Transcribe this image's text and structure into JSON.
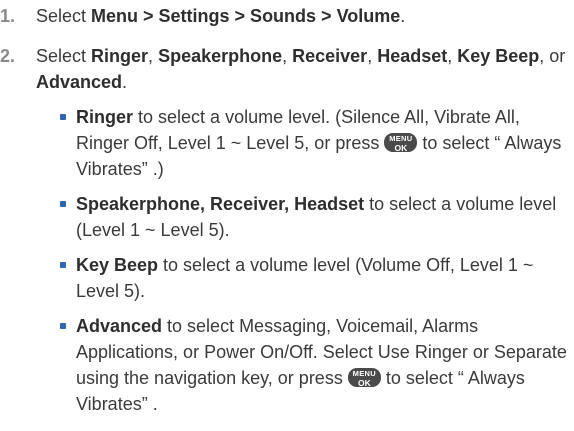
{
  "steps": [
    {
      "num": "1.",
      "text": {
        "pre": "Select ",
        "bold": "Menu > Settings > Sounds > Volume",
        "post": "."
      }
    },
    {
      "num": "2.",
      "text": {
        "pre": "Select ",
        "b1": "Ringer",
        "s1": ", ",
        "b2": "Speakerphone",
        "s2": ", ",
        "b3": "Receiver",
        "s3": ", ",
        "b4": "Headset",
        "s4": ", ",
        "b5": "Key Beep",
        "s5": ", or ",
        "b6": "Advanced",
        "post": "."
      },
      "subs": [
        {
          "bold": "Ringer",
          "text": " to select a volume level. (Silence All, Vibrate All, Ringer Off, Level 1 ~ Level 5, or press ",
          "after_key": " to select “ Always Vibrates” .)"
        },
        {
          "bold": "Speakerphone, Receiver, Headset",
          "text": " to select a volume level (Level 1 ~ Level 5)."
        },
        {
          "bold": "Key Beep",
          "text": " to select a volume level (Volume Off, Level 1 ~ Level 5)."
        },
        {
          "bold": "Advanced",
          "text": " to select Messaging, Voicemail, Alarms Applications, or Power On/Off. Select Use Ringer or Separate using the navigation key, or press ",
          "after_key": " to select “ Always Vibrates” ."
        }
      ]
    }
  ],
  "menu_key": {
    "top": "MENU",
    "bottom": "OK",
    "icon": "menu-ok-key-icon"
  },
  "colors": {
    "text": "#3a3a3a",
    "step_number": "#8a8a8a",
    "bullet": "#2e66b1",
    "key_background": "#4a4a4a"
  }
}
